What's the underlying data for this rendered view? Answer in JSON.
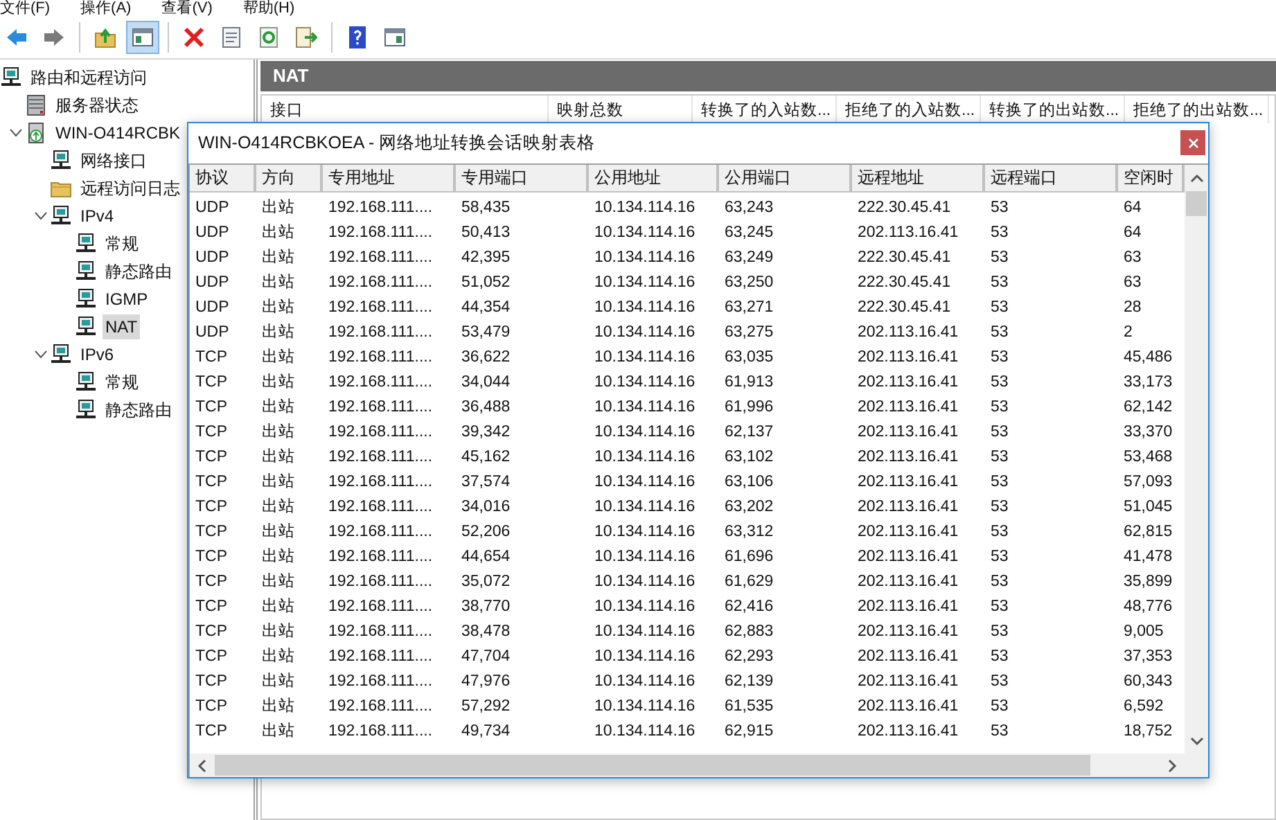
{
  "menu": [
    "文件(F)",
    "操作(A)",
    "查看(V)",
    "帮助(H)"
  ],
  "toolbar": [
    {
      "kind": "back",
      "pressed": false
    },
    {
      "kind": "forward",
      "pressed": false
    },
    {
      "kind": "separator"
    },
    {
      "kind": "up",
      "pressed": false
    },
    {
      "kind": "tree",
      "pressed": true
    },
    {
      "kind": "separator"
    },
    {
      "kind": "delete",
      "pressed": false
    },
    {
      "kind": "properties",
      "pressed": false
    },
    {
      "kind": "refresh",
      "pressed": false
    },
    {
      "kind": "export",
      "pressed": false
    },
    {
      "kind": "separator"
    },
    {
      "kind": "help",
      "pressed": false
    },
    {
      "kind": "panel",
      "pressed": false
    }
  ],
  "tree": [
    {
      "label": "路由和远程访问",
      "kind": "computer",
      "selected": false,
      "children": [
        {
          "label": "服务器状态",
          "kind": "servers",
          "selected": false
        },
        {
          "label": "WIN-O414RCBK",
          "kind": "server",
          "selected": false,
          "expanded": true,
          "children": [
            {
              "label": "网络接口",
              "kind": "computer",
              "selected": false
            },
            {
              "label": "远程访问日志",
              "kind": "folder",
              "selected": false
            },
            {
              "label": "IPv4",
              "kind": "computer",
              "selected": false,
              "expanded": true,
              "children": [
                {
                  "label": "常规",
                  "kind": "computer",
                  "selected": false
                },
                {
                  "label": "静态路由",
                  "kind": "computer",
                  "selected": false
                },
                {
                  "label": "IGMP",
                  "kind": "computer",
                  "selected": false
                },
                {
                  "label": "NAT",
                  "kind": "computer",
                  "selected": true
                }
              ]
            },
            {
              "label": "IPv6",
              "kind": "computer",
              "selected": false,
              "expanded": true,
              "children": [
                {
                  "label": "常规",
                  "kind": "computer",
                  "selected": false
                },
                {
                  "label": "静态路由",
                  "kind": "computer",
                  "selected": false
                }
              ]
            }
          ]
        }
      ]
    }
  ],
  "pane": {
    "title": "NAT",
    "columns": [
      "接口",
      "映射总数",
      "转换了的入站数...",
      "拒绝了的入站数...",
      "转换了的出站数...",
      "拒绝了的出站数..."
    ]
  },
  "dialog": {
    "title": "WIN-O414RCBKOEA - 网络地址转换会话映射表格",
    "columns": [
      "协议",
      "方向",
      "专用地址",
      "专用端口",
      "公用地址",
      "公用端口",
      "远程地址",
      "远程端口",
      "空闲时"
    ],
    "rows": [
      [
        "UDP",
        "出站",
        "192.168.111....",
        "58,435",
        "10.134.114.16",
        "63,243",
        "222.30.45.41",
        "53",
        "64"
      ],
      [
        "UDP",
        "出站",
        "192.168.111....",
        "50,413",
        "10.134.114.16",
        "63,245",
        "202.113.16.41",
        "53",
        "64"
      ],
      [
        "UDP",
        "出站",
        "192.168.111....",
        "42,395",
        "10.134.114.16",
        "63,249",
        "222.30.45.41",
        "53",
        "63"
      ],
      [
        "UDP",
        "出站",
        "192.168.111....",
        "51,052",
        "10.134.114.16",
        "63,250",
        "222.30.45.41",
        "53",
        "63"
      ],
      [
        "UDP",
        "出站",
        "192.168.111....",
        "44,354",
        "10.134.114.16",
        "63,271",
        "222.30.45.41",
        "53",
        "28"
      ],
      [
        "UDP",
        "出站",
        "192.168.111....",
        "53,479",
        "10.134.114.16",
        "63,275",
        "202.113.16.41",
        "53",
        "2"
      ],
      [
        "TCP",
        "出站",
        "192.168.111....",
        "36,622",
        "10.134.114.16",
        "63,035",
        "202.113.16.41",
        "53",
        "45,486"
      ],
      [
        "TCP",
        "出站",
        "192.168.111....",
        "34,044",
        "10.134.114.16",
        "61,913",
        "202.113.16.41",
        "53",
        "33,173"
      ],
      [
        "TCP",
        "出站",
        "192.168.111....",
        "36,488",
        "10.134.114.16",
        "61,996",
        "202.113.16.41",
        "53",
        "62,142"
      ],
      [
        "TCP",
        "出站",
        "192.168.111....",
        "39,342",
        "10.134.114.16",
        "62,137",
        "202.113.16.41",
        "53",
        "33,370"
      ],
      [
        "TCP",
        "出站",
        "192.168.111....",
        "45,162",
        "10.134.114.16",
        "63,102",
        "202.113.16.41",
        "53",
        "53,468"
      ],
      [
        "TCP",
        "出站",
        "192.168.111....",
        "37,574",
        "10.134.114.16",
        "63,106",
        "202.113.16.41",
        "53",
        "57,093"
      ],
      [
        "TCP",
        "出站",
        "192.168.111....",
        "34,016",
        "10.134.114.16",
        "63,202",
        "202.113.16.41",
        "53",
        "51,045"
      ],
      [
        "TCP",
        "出站",
        "192.168.111....",
        "52,206",
        "10.134.114.16",
        "63,312",
        "202.113.16.41",
        "53",
        "62,815"
      ],
      [
        "TCP",
        "出站",
        "192.168.111....",
        "44,654",
        "10.134.114.16",
        "61,696",
        "202.113.16.41",
        "53",
        "41,478"
      ],
      [
        "TCP",
        "出站",
        "192.168.111....",
        "35,072",
        "10.134.114.16",
        "61,629",
        "202.113.16.41",
        "53",
        "35,899"
      ],
      [
        "TCP",
        "出站",
        "192.168.111....",
        "38,770",
        "10.134.114.16",
        "62,416",
        "202.113.16.41",
        "53",
        "48,776"
      ],
      [
        "TCP",
        "出站",
        "192.168.111....",
        "38,478",
        "10.134.114.16",
        "62,883",
        "202.113.16.41",
        "53",
        "9,005"
      ],
      [
        "TCP",
        "出站",
        "192.168.111....",
        "47,704",
        "10.134.114.16",
        "62,293",
        "202.113.16.41",
        "53",
        "37,353"
      ],
      [
        "TCP",
        "出站",
        "192.168.111....",
        "47,976",
        "10.134.114.16",
        "62,139",
        "202.113.16.41",
        "53",
        "60,343"
      ],
      [
        "TCP",
        "出站",
        "192.168.111....",
        "57,292",
        "10.134.114.16",
        "61,535",
        "202.113.16.41",
        "53",
        "6,592"
      ],
      [
        "TCP",
        "出站",
        "192.168.111....",
        "49,734",
        "10.134.114.16",
        "62,915",
        "202.113.16.41",
        "53",
        "18,752"
      ]
    ]
  }
}
